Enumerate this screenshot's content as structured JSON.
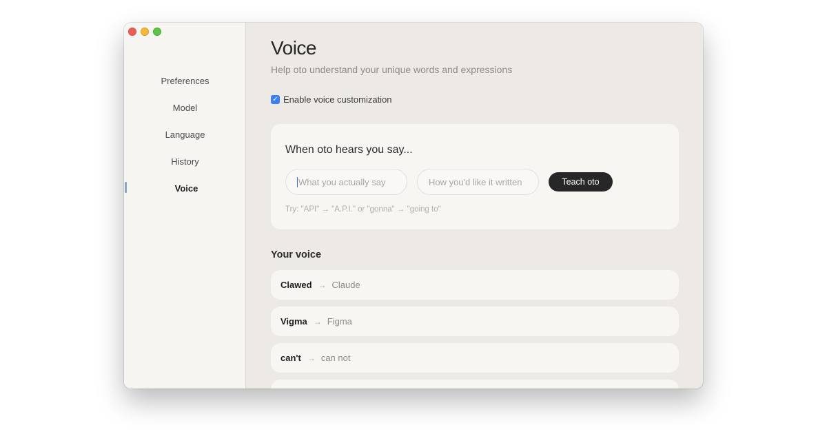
{
  "window": {
    "traffic_lights": [
      "close",
      "minimize",
      "zoom"
    ]
  },
  "sidebar": {
    "items": [
      {
        "label": "Preferences",
        "active": false
      },
      {
        "label": "Model",
        "active": false
      },
      {
        "label": "Language",
        "active": false
      },
      {
        "label": "History",
        "active": false
      },
      {
        "label": "Voice",
        "active": true
      }
    ]
  },
  "main": {
    "title": "Voice",
    "subtitle": "Help oto understand your unique words and expressions",
    "enable_checkbox": {
      "label": "Enable voice customization",
      "checked": true
    },
    "teach_card": {
      "title": "When oto hears you say...",
      "input_said_placeholder": "What you actually say",
      "input_written_placeholder": "How you'd like it written",
      "button_label": "Teach oto",
      "hint": "Try: \"API\" → \"A.P.I.\" or \"gonna\" → \"going to\""
    },
    "voice_section": {
      "title": "Your voice",
      "arrow_icon": "→",
      "entries": [
        {
          "from": "Clawed",
          "to": "Claude"
        },
        {
          "from": "Vigma",
          "to": "Figma"
        },
        {
          "from": "can't",
          "to": "can not"
        }
      ]
    }
  },
  "colors": {
    "accent": "#3d7ff0",
    "button_bg": "#272727",
    "window_bg": "#edeae5",
    "sidebar_bg": "#f6f5f2",
    "card_bg": "#f7f6f3"
  }
}
